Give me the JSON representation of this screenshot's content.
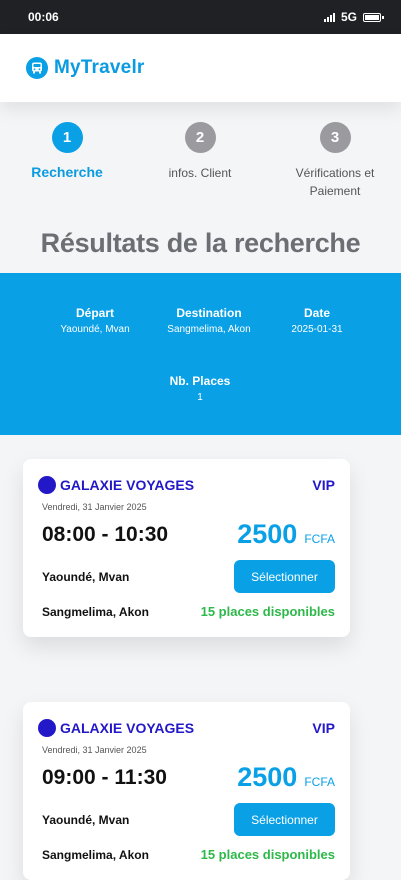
{
  "status_bar": {
    "time": "00:06",
    "network": "5G"
  },
  "app": {
    "name": "MyTravelr"
  },
  "stepper": {
    "steps": [
      {
        "number": "1",
        "label": "Recherche"
      },
      {
        "number": "2",
        "label": "infos. Client"
      },
      {
        "number": "3",
        "label": "Vérifications et Paiement"
      }
    ]
  },
  "results_title": "Résultats de la recherche",
  "search": {
    "departure_label": "Départ",
    "departure_value": "Yaoundé, Mvan",
    "destination_label": "Destination",
    "destination_value": "Sangmelima, Akon",
    "date_label": "Date",
    "date_value": "2025-01-31",
    "seats_label": "Nb. Places",
    "seats_value": "1"
  },
  "results": [
    {
      "company": "GALAXIE VOYAGES",
      "class": "VIP",
      "date": "Vendredi, 31 Janvier 2025",
      "time": "08:00 - 10:30",
      "price": "2500",
      "currency": "FCFA",
      "from": "Yaoundé, Mvan",
      "to": "Sangmelima, Akon",
      "button": "Sélectionner",
      "availability": "15 places disponibles"
    },
    {
      "company": "GALAXIE VOYAGES",
      "class": "VIP",
      "date": "Vendredi, 31 Janvier 2025",
      "time": "09:00 - 11:30",
      "price": "2500",
      "currency": "FCFA",
      "from": "Yaoundé, Mvan",
      "to": "Sangmelima, Akon",
      "button": "Sélectionner",
      "availability": "15 places disponibles"
    }
  ],
  "colors": {
    "primary": "#0aa0e6",
    "company": "#2318c8",
    "available": "#2eb84a",
    "title": "#6b6e73"
  },
  "icons": {
    "logo": "bus-icon"
  }
}
